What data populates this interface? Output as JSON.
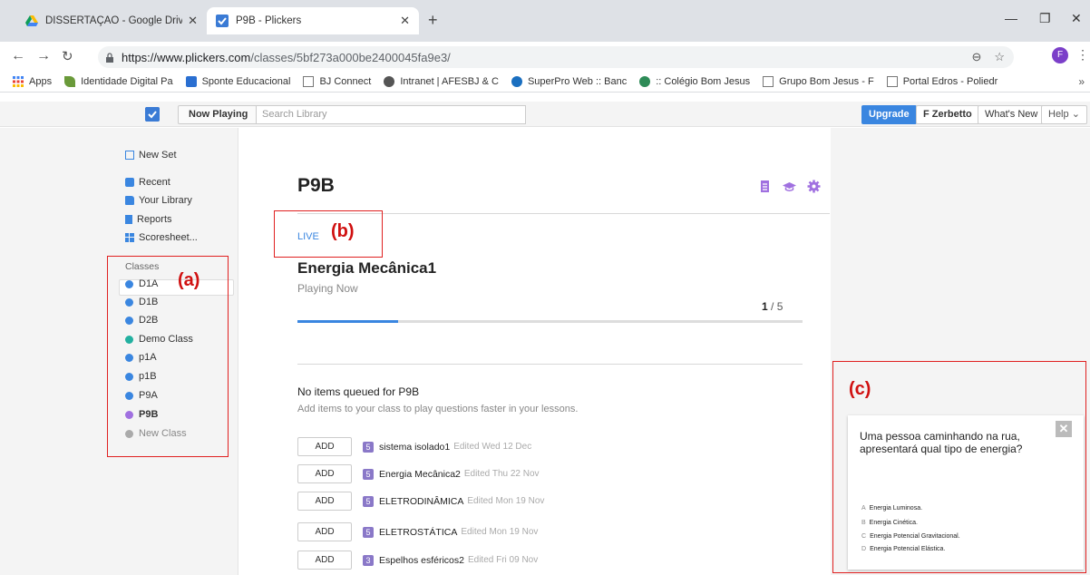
{
  "browser": {
    "tabs": [
      {
        "label": "DISSERTAÇÃO - Google Drive",
        "icon": "google-drive-icon"
      },
      {
        "label": "P9B - Plickers",
        "icon": "plickers-icon"
      }
    ],
    "url_host": "https://www.plickers.com",
    "url_path": "/classes/5bf273a000be2400045fa9e3/",
    "profile_initial": "F",
    "bookmarks": [
      {
        "label": "Apps",
        "icon": "apps-grid-icon"
      },
      {
        "label": "Identidade Digital Pa",
        "icon": "leaf-icon"
      },
      {
        "label": "Sponte Educacional",
        "icon": "sponte-icon"
      },
      {
        "label": "BJ Connect",
        "icon": "page-icon"
      },
      {
        "label": "Intranet | AFESBJ & C",
        "icon": "intranet-icon"
      },
      {
        "label": "SuperPro Web :: Banc",
        "icon": "superpro-icon"
      },
      {
        "label": ":: Colégio Bom Jesus",
        "icon": "globe-icon"
      },
      {
        "label": "Grupo Bom Jesus - F",
        "icon": "page-icon"
      },
      {
        "label": "Portal Edros - Poliedr",
        "icon": "page-icon"
      }
    ]
  },
  "appbar": {
    "now_playing": "Now Playing",
    "search_placeholder": "Search Library",
    "upgrade": "Upgrade",
    "user": "F Zerbetto",
    "whats_new": "What's New",
    "help": "Help",
    "accent": "#3a86e0"
  },
  "sidebar": {
    "items": [
      {
        "label": "New Set",
        "icon": "edit-icon"
      },
      {
        "label": "Recent",
        "icon": "recent-icon"
      },
      {
        "label": "Your Library",
        "icon": "folder-icon"
      },
      {
        "label": "Reports",
        "icon": "report-icon"
      },
      {
        "label": "Scoresheet...",
        "icon": "grid-icon"
      }
    ],
    "classes_heading": "Classes",
    "classes": [
      {
        "label": "D1A",
        "color": "#3a86e0"
      },
      {
        "label": "D1B",
        "color": "#3a86e0"
      },
      {
        "label": "D2B",
        "color": "#3a86e0"
      },
      {
        "label": "Demo Class",
        "color": "#22b0a0"
      },
      {
        "label": "p1A",
        "color": "#3a86e0"
      },
      {
        "label": "p1B",
        "color": "#3a86e0"
      },
      {
        "label": "P9A",
        "color": "#3a86e0"
      },
      {
        "label": "P9B",
        "color": "#a070e0"
      }
    ],
    "new_class": "New Class"
  },
  "main": {
    "class_title": "P9B",
    "live": "LIVE",
    "set_title": "Energia Mecânica1",
    "playing_now": "Playing Now",
    "counter_current": "1",
    "counter_sep": "/",
    "counter_total": "5",
    "progress_fraction": 0.2,
    "queue_title": "No items queued for P9B",
    "queue_sub": "Add items to your class to play questions faster in your lessons.",
    "add_label": "ADD",
    "queue": [
      {
        "count": "5",
        "name": "sistema isolado1",
        "edited": "Edited Wed 12 Dec"
      },
      {
        "count": "5",
        "name": "Energia Mecânica2",
        "edited": "Edited Thu 22 Nov"
      },
      {
        "count": "5",
        "name": "ELETRODINÂMICA",
        "edited": "Edited Mon 19 Nov"
      },
      {
        "count": "5",
        "name": "ELETROSTÁTICA",
        "edited": "Edited Mon 19 Nov"
      },
      {
        "count": "3",
        "name": "Espelhos esféricos2",
        "edited": "Edited Fri 09 Nov"
      }
    ]
  },
  "question": {
    "text": "Uma pessoa caminhando na rua, apresentará qual tipo de energia?",
    "options": [
      {
        "letter": "A",
        "text": "Energia Luminosa."
      },
      {
        "letter": "B",
        "text": "Energia Cinética."
      },
      {
        "letter": "C",
        "text": "Energia Potencial Gravitacional."
      },
      {
        "letter": "D",
        "text": "Energia Potencial Elástica."
      }
    ]
  },
  "annotations": {
    "a": "(a)",
    "b": "(b)",
    "c": "(c)",
    "color": "#e02020"
  }
}
